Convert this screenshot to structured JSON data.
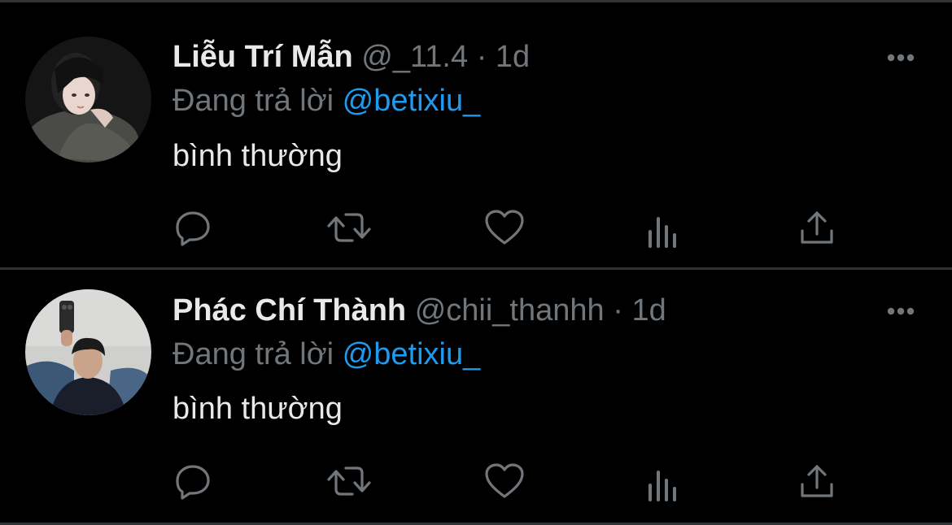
{
  "theme": {
    "background": "#000000",
    "divider": "#2f3336",
    "text": "#e7e9ea",
    "muted": "#71767b",
    "accent": "#1d9bf0"
  },
  "tweets": [
    {
      "display_name": "Liễu Trí Mẫn",
      "handle": "@_11.4",
      "separator": "·",
      "time": "1d",
      "reply_prefix": "Đang trả lời",
      "reply_to": "@betixiu_",
      "text": "bình thường",
      "avatar_icon": "avatar-woman-photo",
      "actions": [
        "reply-icon",
        "retweet-icon",
        "like-icon",
        "analytics-icon",
        "share-icon"
      ]
    },
    {
      "display_name": "Phác Chí Thành",
      "handle": "@chii_thanhh",
      "separator": "·",
      "time": "1d",
      "reply_prefix": "Đang trả lời",
      "reply_to": "@betixiu_",
      "text": "bình thường",
      "avatar_icon": "avatar-man-mirror-selfie",
      "actions": [
        "reply-icon",
        "retweet-icon",
        "like-icon",
        "analytics-icon",
        "share-icon"
      ]
    }
  ]
}
